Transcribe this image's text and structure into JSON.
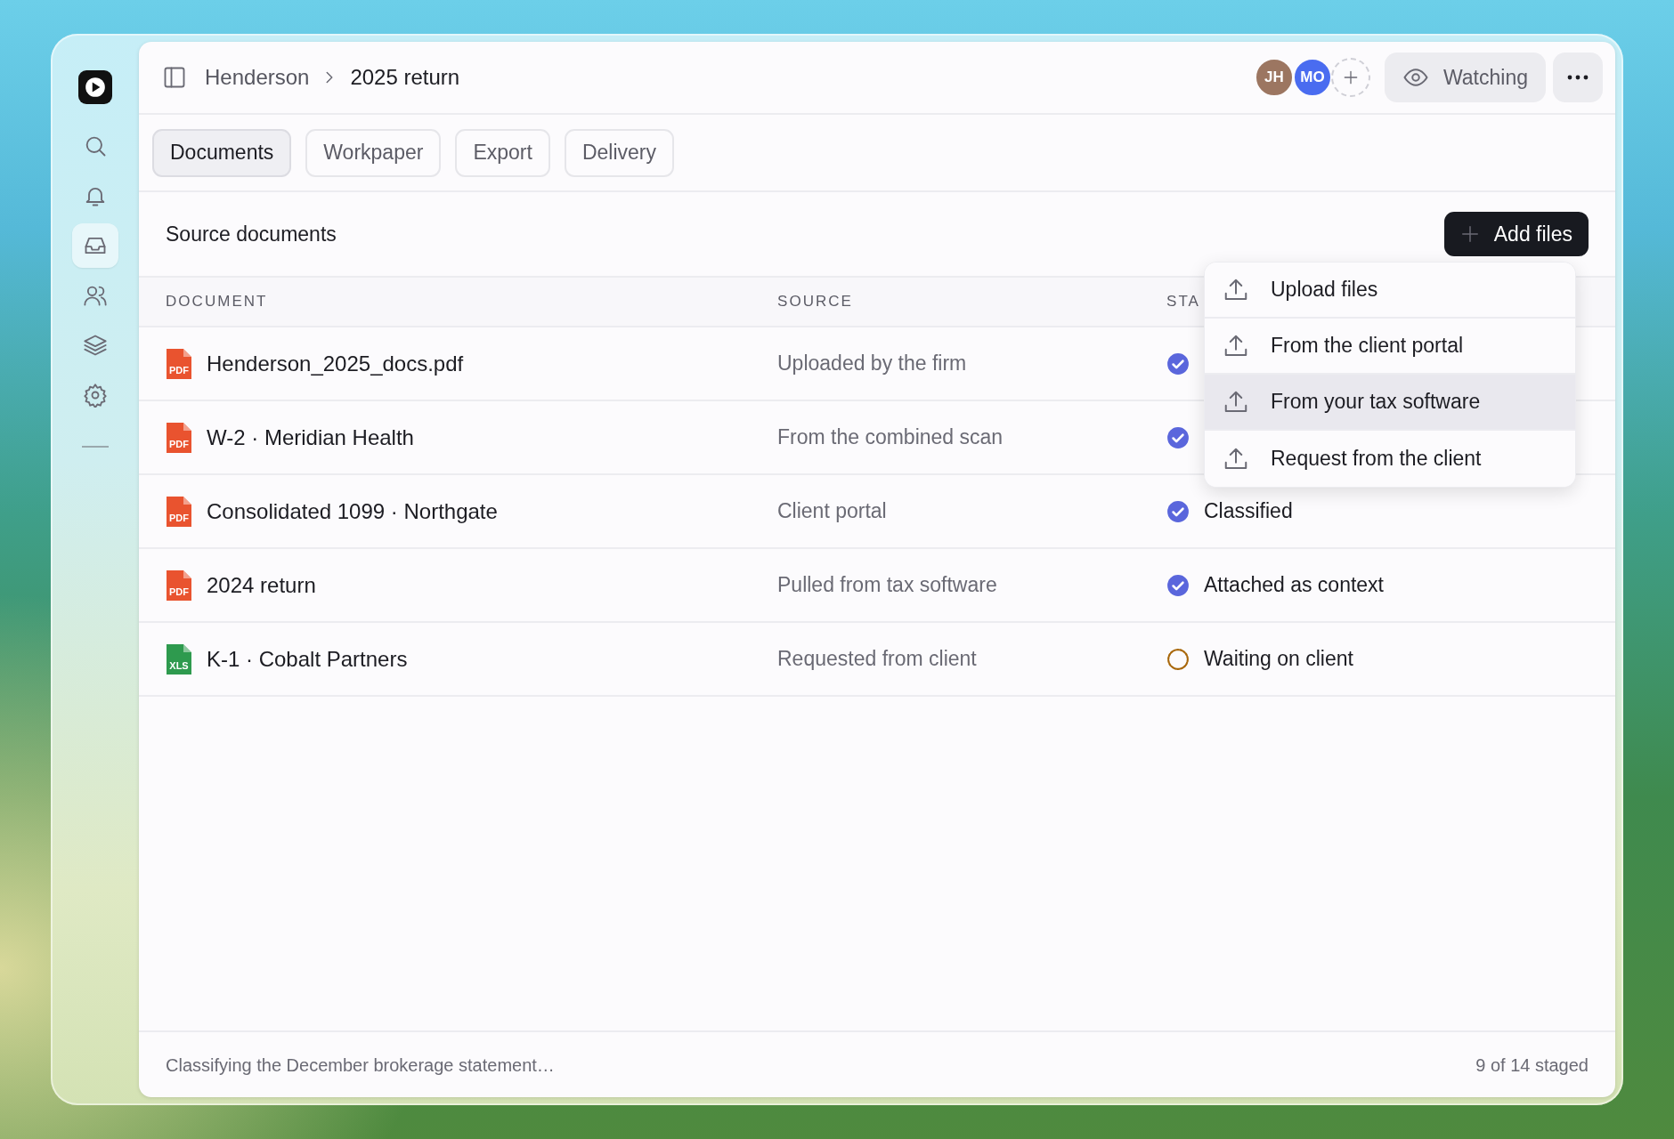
{
  "sidebar": {
    "items": [
      {
        "selected": false
      },
      {
        "selected": false
      },
      {
        "selected": true
      },
      {
        "selected": false
      },
      {
        "selected": false
      },
      {
        "selected": false
      }
    ]
  },
  "breadcrumb": [
    "Henderson",
    "2025 return"
  ],
  "avatars": [
    {
      "initials": "JH",
      "color": "#9c7661"
    },
    {
      "initials": "MO",
      "color": "#4a6cf0"
    }
  ],
  "watch_button": {
    "label": "Watching"
  },
  "tabs": [
    {
      "label": "Documents",
      "selected": true
    },
    {
      "label": "Workpaper",
      "selected": false
    },
    {
      "label": "Export",
      "selected": false
    },
    {
      "label": "Delivery",
      "selected": false
    }
  ],
  "section": {
    "title": "Source documents",
    "add_button": "Add files"
  },
  "table": {
    "columns": [
      "DOCUMENT",
      "SOURCE",
      "STA"
    ],
    "rows": [
      {
        "name": "Henderson_2025_docs.pdf",
        "file_label": "PDF",
        "color": "#e9532f",
        "source": "Uploaded by the firm",
        "status": {
          "kind": "done"
        }
      },
      {
        "name": "W-2 · Meridian Health",
        "file_label": "PDF",
        "color": "#e9532f",
        "source": "From the combined scan",
        "status": {
          "kind": "done"
        }
      },
      {
        "name": "Consolidated 1099 · Northgate",
        "file_label": "PDF",
        "color": "#e9532f",
        "source": "Client portal",
        "status": {
          "kind": "done",
          "text": "Classified"
        }
      },
      {
        "name": "2024 return",
        "file_label": "PDF",
        "color": "#e9532f",
        "source": "Pulled from tax software",
        "status": {
          "kind": "done",
          "text": "Attached as context"
        }
      },
      {
        "name": "K-1 · Cobalt Partners",
        "file_label": "XLS",
        "color": "#2e9a4e",
        "source": "Requested from client",
        "status": {
          "kind": "waiting",
          "text": "Waiting on client"
        }
      }
    ]
  },
  "menu": {
    "items": [
      {
        "label": "Upload files",
        "selected": false
      },
      {
        "label": "From the client portal",
        "selected": false
      },
      {
        "label": "From your tax software",
        "selected": true
      },
      {
        "label": "Request from the client",
        "selected": false
      }
    ]
  },
  "footer": {
    "message": "Classifying the December brokerage statement…",
    "count": "9 of 14 staged"
  }
}
